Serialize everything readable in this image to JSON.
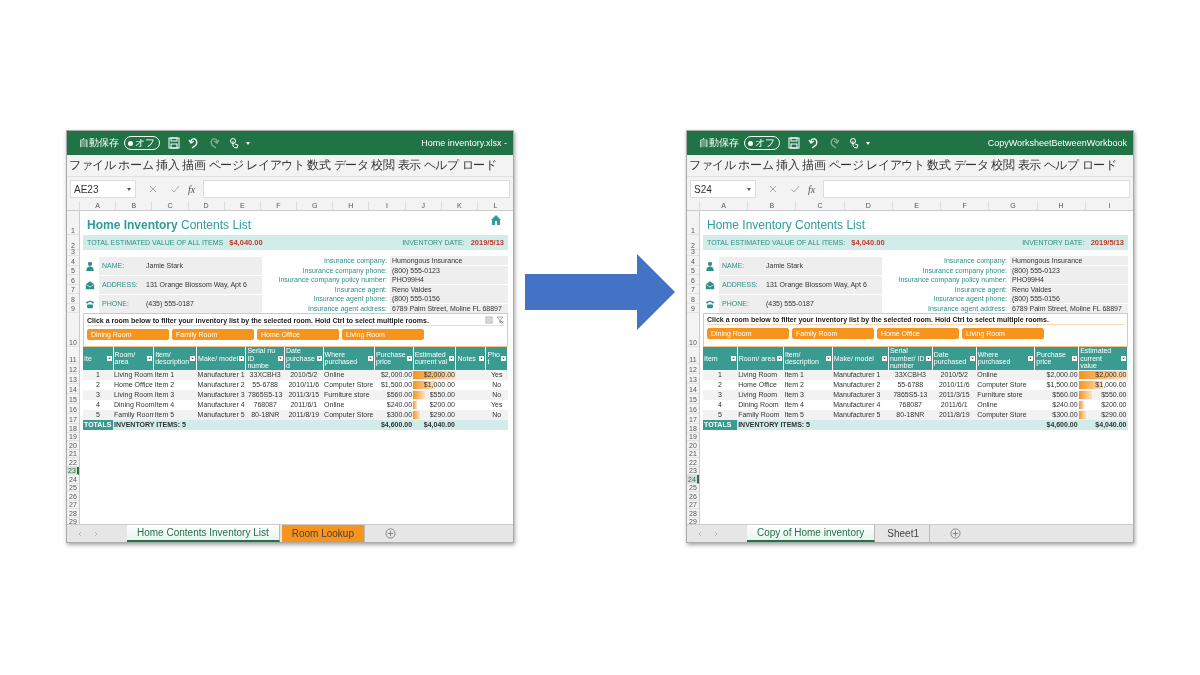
{
  "windows": [
    {
      "title_bar": {
        "autosave_label": "自動保存",
        "toggle_label": "オフ",
        "toggle_on": false,
        "title": "Home inventory.xlsx -"
      },
      "menu": [
        "ファイル",
        "ホーム",
        "挿入",
        "描画",
        "ページ レイアウト",
        "数式",
        "データ",
        "校閲",
        "表示",
        "ヘルプ",
        "ロード"
      ],
      "formula_bar": {
        "name_box": "AE23",
        "function_label": "fx"
      },
      "column_letters": [
        "A",
        "B",
        "C",
        "D",
        "E",
        "F",
        "G",
        "H",
        "I",
        "J",
        "K",
        "L"
      ],
      "row_numbers": [
        {
          "label": "1",
          "selected": false
        },
        {
          "label": "2",
          "selected": false
        },
        {
          "label": "3",
          "selected": false
        },
        {
          "label": "4",
          "selected": false
        },
        {
          "label": "5",
          "selected": false
        },
        {
          "label": "6",
          "selected": false
        },
        {
          "label": "7",
          "selected": false
        },
        {
          "label": "8",
          "selected": false
        },
        {
          "label": "9",
          "selected": false
        },
        {
          "label": "10",
          "selected": false
        },
        {
          "label": "11",
          "selected": false
        },
        {
          "label": "12",
          "selected": false
        },
        {
          "label": "13",
          "selected": false
        },
        {
          "label": "14",
          "selected": false
        },
        {
          "label": "15",
          "selected": false
        },
        {
          "label": "16",
          "selected": false
        },
        {
          "label": "17",
          "selected": false
        },
        {
          "label": "18",
          "selected": false
        },
        {
          "label": "19",
          "selected": false
        },
        {
          "label": "20",
          "selected": false
        },
        {
          "label": "21",
          "selected": false
        },
        {
          "label": "22",
          "selected": false
        },
        {
          "label": "23",
          "selected": true
        },
        {
          "label": "24",
          "selected": false
        },
        {
          "label": "25",
          "selected": false
        },
        {
          "label": "26",
          "selected": false
        },
        {
          "label": "27",
          "selected": false
        },
        {
          "label": "28",
          "selected": false
        },
        {
          "label": "29",
          "selected": false
        }
      ],
      "sheet": {
        "title": "**Home Inventory** Contents List",
        "home_icon": true,
        "summary": {
          "total_label": "TOTAL ESTIMATED VALUE OF ALL ITEMS",
          "total_value": "$4,040.00",
          "date_label": "INVENTORY DATE:",
          "date_value": "2019/5/13"
        },
        "owner": [
          {
            "kind": "person",
            "label": "NAME:",
            "value": "Jamie Stark"
          },
          {
            "kind": "mail",
            "label": "ADDRESS:",
            "value": "131 Orange Blossom Way, Apt 6"
          },
          {
            "kind": "phone",
            "label": "PHONE:",
            "value": "(435) 555-0187"
          }
        ],
        "insurance": [
          {
            "label": "Insurance company:",
            "value": "Humongous Insurance"
          },
          {
            "label": "Insurance company phone:",
            "value": "(800) 555-0123"
          },
          {
            "label": "Insurance company policy number:",
            "value": "PHO99H4"
          },
          {
            "label": "Insurance agent:",
            "value": "Reno Valdes"
          },
          {
            "label": "Insurance agent phone:",
            "value": "(800) 555-0156"
          },
          {
            "label": "Insurance agent address:",
            "value": "6789 Palm Street, Moline FL 68897"
          }
        ],
        "slicer": {
          "instruction": "Click a room below to filter your inventory list by the selected room. Hold Ctrl to select multiple rooms.",
          "tool_icons": true,
          "buttons": [
            {
              "label": "Dining Room",
              "selected": true
            },
            {
              "label": "Family Room",
              "selected": true
            },
            {
              "label": "Home Office",
              "selected": true
            },
            {
              "label": "Living Room",
              "selected": true
            }
          ]
        },
        "table": {
          "columns": [
            {
              "label": "Ite",
              "kind": "item"
            },
            {
              "label": "Room/ area",
              "kind": "room"
            },
            {
              "label": "Item/ description",
              "kind": "desc"
            },
            {
              "label": "Make/ model",
              "kind": "model"
            },
            {
              "label": "Serial nu ID numbe",
              "kind": "serial"
            },
            {
              "label": "Date purchased",
              "kind": "date"
            },
            {
              "label": "Where purchased",
              "kind": "where"
            },
            {
              "label": "Purchase price",
              "kind": "price"
            },
            {
              "label": "Estimated current val",
              "kind": "value"
            },
            {
              "label": "Notes",
              "kind": "notes"
            },
            {
              "label": "Phot",
              "kind": "photo"
            }
          ],
          "rows": [
            {
              "item": "1",
              "room": "Living Room",
              "desc": "Item 1",
              "model": "Manufacturer 1",
              "serial": "33XCBH3",
              "date": "2010/5/2",
              "where": "Online",
              "price": "$2,000.00",
              "value": "$2,000.00",
              "photo": "Yes",
              "level": 1
            },
            {
              "item": "2",
              "room": "Home Office",
              "desc": "Item 2",
              "model": "Manufacturer 2",
              "serial": "55-6788",
              "date": "2010/11/6",
              "where": "Computer Store",
              "price": "$1,500.00",
              "value": "$1,000.00",
              "photo": "No",
              "level": 0.5
            },
            {
              "item": "3",
              "room": "Living Room",
              "desc": "Item 3",
              "model": "Manufacturer 3",
              "serial": "7865S5-13",
              "date": "2011/3/15",
              "where": "Furniture store",
              "price": "$560.00",
              "value": "$550.00",
              "photo": "No",
              "level": 0.28
            },
            {
              "item": "4",
              "room": "Dining Room",
              "desc": "Item 4",
              "model": "Manufacturer 4",
              "serial": "768087",
              "date": "2011/6/1",
              "where": "Online",
              "price": "$240.00",
              "value": "$200.00",
              "photo": "Yes",
              "level": 0.1
            },
            {
              "item": "5",
              "room": "Family Room",
              "desc": "Item 5",
              "model": "Manufacturer 5",
              "serial": "80-18NR",
              "date": "2011/8/19",
              "where": "Computer Store",
              "price": "$300.00",
              "value": "$290.00",
              "photo": "No",
              "level": 0.15
            }
          ],
          "totals": {
            "item": "TOTALS",
            "room": "INVENTORY ITEMS: 5",
            "price": "$4,600.00",
            "value": "$4,040.00"
          }
        }
      },
      "sheet_tabs": [
        {
          "label": "Home Contents Inventory List",
          "selected": true
        },
        {
          "label": "Room Lookup",
          "selected": false,
          "color": "#f7941d"
        }
      ]
    },
    {
      "title_bar": {
        "autosave_label": "自動保存",
        "toggle_label": "オフ",
        "toggle_on": false,
        "title": "CopyWorksheetBetweenWorkbook"
      },
      "menu": [
        "ファイル",
        "ホーム",
        "挿入",
        "描画",
        "ページ レイアウト",
        "数式",
        "データ",
        "校閲",
        "表示",
        "ヘルプ",
        "ロード"
      ],
      "formula_bar": {
        "name_box": "S24",
        "function_label": "fx"
      },
      "column_letters": [
        "A",
        "B",
        "C",
        "D",
        "E",
        "F",
        "G",
        "H",
        "I"
      ],
      "row_numbers": [
        {
          "label": "1",
          "selected": false
        },
        {
          "label": "2",
          "selected": false
        },
        {
          "label": "3",
          "selected": false
        },
        {
          "label": "4",
          "selected": false
        },
        {
          "label": "5",
          "selected": false
        },
        {
          "label": "6",
          "selected": false
        },
        {
          "label": "7",
          "selected": false
        },
        {
          "label": "8",
          "selected": false
        },
        {
          "label": "9",
          "selected": false
        },
        {
          "label": "10",
          "selected": false
        },
        {
          "label": "11",
          "selected": false
        },
        {
          "label": "12",
          "selected": false
        },
        {
          "label": "13",
          "selected": false
        },
        {
          "label": "14",
          "selected": false
        },
        {
          "label": "15",
          "selected": false
        },
        {
          "label": "16",
          "selected": false
        },
        {
          "label": "17",
          "selected": false
        },
        {
          "label": "18",
          "selected": false
        },
        {
          "label": "19",
          "selected": false
        },
        {
          "label": "20",
          "selected": false
        },
        {
          "label": "21",
          "selected": false
        },
        {
          "label": "22",
          "selected": false
        },
        {
          "label": "23",
          "selected": false
        },
        {
          "label": "24",
          "selected": true
        },
        {
          "label": "25",
          "selected": false
        },
        {
          "label": "26",
          "selected": false
        },
        {
          "label": "27",
          "selected": false
        },
        {
          "label": "28",
          "selected": false
        },
        {
          "label": "29",
          "selected": false
        }
      ],
      "sheet": {
        "title": "Home Inventory Contents List",
        "home_icon": false,
        "summary": {
          "total_label": "TOTAL ESTIMATED VALUE OF ALL ITEMS:",
          "total_value": "$4,040.00",
          "date_label": "INVENTORY DATE:",
          "date_value": "2019/5/13"
        },
        "owner": [
          {
            "kind": "person",
            "label": "NAME:",
            "value": "Jamie Stark"
          },
          {
            "kind": "mail",
            "label": "ADDRESS:",
            "value": "131 Orange Blossom Way, Apt 6"
          },
          {
            "kind": "phone",
            "label": "PHONE:",
            "value": "(435) 555-0187"
          }
        ],
        "insurance": [
          {
            "label": "Insurance company:",
            "value": "Humongous Insurance"
          },
          {
            "label": "Insurance company phone:",
            "value": "(800) 555-0123"
          },
          {
            "label": "Insurance company policy number:",
            "value": "PHO99H4"
          },
          {
            "label": "Insurance agent:",
            "value": "Reno Valdes"
          },
          {
            "label": "Insurance agent phone:",
            "value": "(800) 555-0156"
          },
          {
            "label": "Insurance agent address:",
            "value": "6789 Palm Street, Moline FL 68897"
          }
        ],
        "slicer": {
          "instruction": "Click a room below to filter your inventory list by the selected room. Hold Ctrl to select multiple rooms.",
          "tool_icons": false,
          "buttons": [
            {
              "label": "Dining Room",
              "selected": true
            },
            {
              "label": "Family Room",
              "selected": true
            },
            {
              "label": "Home Office",
              "selected": true
            },
            {
              "label": "Living Room",
              "selected": true
            }
          ]
        },
        "table": {
          "columns": [
            {
              "label": "Item",
              "kind": "item"
            },
            {
              "label": "Room/ area",
              "kind": "room"
            },
            {
              "label": "Item/ description",
              "kind": "desc"
            },
            {
              "label": "Make/ model",
              "kind": "model"
            },
            {
              "label": "Serial number/ ID number",
              "kind": "serial"
            },
            {
              "label": "Date purchased",
              "kind": "date"
            },
            {
              "label": "Where purchased",
              "kind": "where"
            },
            {
              "label": "Purchase price",
              "kind": "price"
            },
            {
              "label": "Estimated current value",
              "kind": "value"
            }
          ],
          "rows": [
            {
              "item": "1",
              "room": "Living Room",
              "desc": "Item 1",
              "model": "Manufacturer 1",
              "serial": "33XCBH3",
              "date": "2010/5/2",
              "where": "Online",
              "price": "$2,000.00",
              "value": "$2,000.00",
              "level": 1
            },
            {
              "item": "2",
              "room": "Home Office",
              "desc": "Item 2",
              "model": "Manufacturer 2",
              "serial": "55-6788",
              "date": "2010/11/6",
              "where": "Computer Store",
              "price": "$1,500.00",
              "value": "$1,000.00",
              "level": 0.5
            },
            {
              "item": "3",
              "room": "Living Room",
              "desc": "Item 3",
              "model": "Manufacturer 3",
              "serial": "7865S5-13",
              "date": "2011/3/15",
              "where": "Furniture store",
              "price": "$560.00",
              "value": "$550.00",
              "level": 0.28
            },
            {
              "item": "4",
              "room": "Dining Room",
              "desc": "Item 4",
              "model": "Manufacturer 4",
              "serial": "768087",
              "date": "2011/6/1",
              "where": "Online",
              "price": "$240.00",
              "value": "$200.00",
              "level": 0.1
            },
            {
              "item": "5",
              "room": "Family Room",
              "desc": "Item 5",
              "model": "Manufacturer 5",
              "serial": "80-18NR",
              "date": "2011/8/19",
              "where": "Computer Store",
              "price": "$300.00",
              "value": "$290.00",
              "level": 0.15
            }
          ],
          "totals": {
            "item": "TOTALS",
            "room": "INVENTORY ITEMS: 5",
            "price": "$4,600.00",
            "value": "$4,040.00"
          }
        }
      },
      "sheet_tabs": [
        {
          "label": "Copy of Home inventory",
          "selected": true
        },
        {
          "label": "Sheet1",
          "selected": false
        }
      ]
    }
  ]
}
